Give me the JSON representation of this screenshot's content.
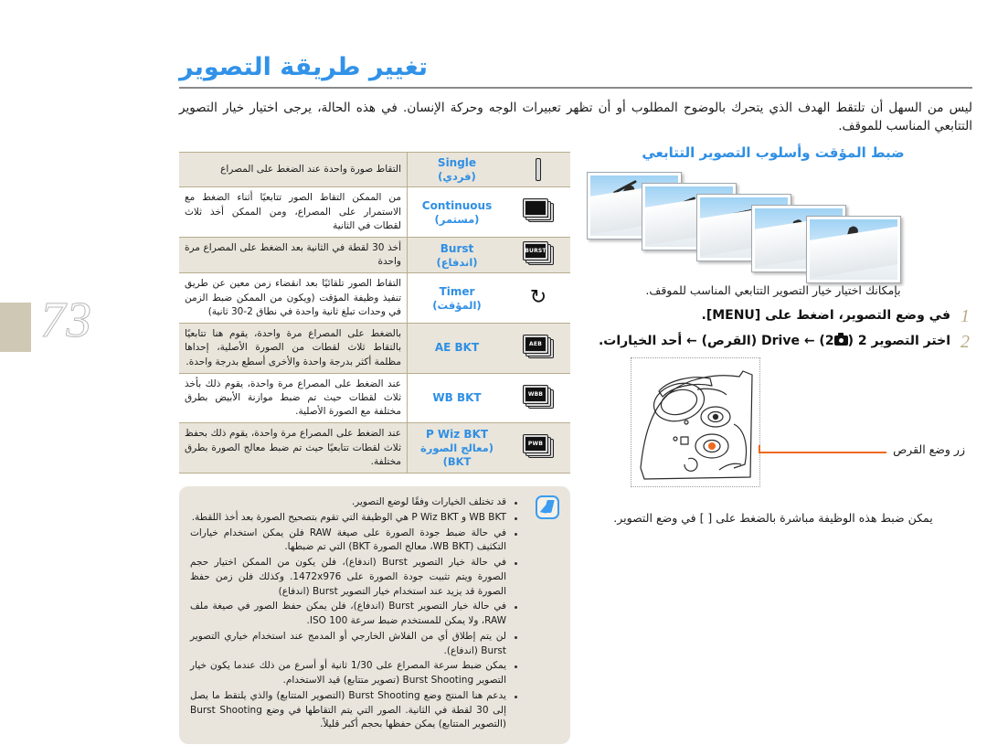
{
  "page": {
    "number": "73",
    "title": "تغيير طريقة التصوير",
    "intro": "ليس من السهل أن تلتقط الهدف الذي يتحرك بالوضوح المطلوب أو أن تظهر تعبيرات الوجه وحركة الإنسان. في هذه الحالة، يرجى اختيار خيار التصوير التتابعي المناسب للموقف."
  },
  "table": {
    "rows": [
      {
        "icon": "single-frame-icon",
        "name_en": "Single",
        "name_ar": "(فردي)",
        "desc": "التقاط صورة واحدة عند الضغط على المصراع"
      },
      {
        "icon": "continuous-frames-icon",
        "name_en": "Continuous",
        "name_ar": "(مستمر)",
        "desc": "من الممكن التقاط الصور تتابعيًا أثناء الضغط مع الاستمرار على المصراع، ومن الممكن أخذ ثلاث لقطات في الثانية"
      },
      {
        "icon": "burst-icon",
        "name_en": "Burst",
        "name_ar": "(اندفاع)",
        "desc": "أخذ 30 لقطة في الثانية بعد الضغط على المصراع مرة واحدة"
      },
      {
        "icon": "timer-icon",
        "name_en": "Timer",
        "name_ar": "(المؤقت)",
        "desc": "التقاط الصور تلقائيًا بعد انقضاء زمن معين عن طريق تنفيذ وظيفة المؤقت (ويكون من الممكن ضبط الزمن في وحدات تبلغ ثانية واحدة في نطاق 2-30 ثانية)"
      },
      {
        "icon": "aeb-icon",
        "name_en": "AE BKT",
        "name_ar": "",
        "desc": "بالضغط على المصراع مرة واحدة، يقوم هنا تتابعيًا بالتقاط ثلاث لقطات من الصورة الأصلية، إحداها مظلمة أكثر بدرجة واحدة والأخرى أسطع بدرجة واحدة."
      },
      {
        "icon": "wbb-icon",
        "name_en": "WB BKT",
        "name_ar": "",
        "desc": "عند الضغط على المصراع مرة واحدة، يقوم ذلك بأخذ ثلاث لقطات حيث تم ضبط موازنة الأبيض بطرق مختلفة مع الصورة الأصلية."
      },
      {
        "icon": "pwb-icon",
        "name_en": "P Wiz BKT",
        "name_ar": "(معالج الصورة BKT)",
        "desc": "عند الضغط على المصراع مرة واحدة، يقوم ذلك بحفظ ثلاث لقطات تتابعيًا حيث تم ضبط معالج الصورة بطرق مختلفة."
      }
    ]
  },
  "note": {
    "icon": "note-pen-icon",
    "items": [
      "قد تختلف الخيارات وفقًا لوضع التصوير.",
      "WB BKT و P Wiz BKT هي الوظيفة التي تقوم بتصحيح الصورة بعد أخذ اللقطة.",
      "في حالة ضبط جودة الصورة على صيغة RAW فلن يمكن استخدام خيارات التكثيف (WB BKT، معالج الصورة BKT) التي تم ضبطها.",
      "في حالة خيار التصوير Burst (اندفاع)، فلن يكون من الممكن اختيار حجم الصورة ويتم تثبيت جودة الصورة على 1472x976. وكذلك فلن زمن حفظ الصورة قد يزيد عند استخدام خيار التصوير Burst (اندفاع)",
      "في حالة خيار التصوير Burst (اندفاع)، فلن يمكن حفظ الصور في صيغة ملف RAW، ولا يمكن للمستخدم ضبط سرعة ISO 100.",
      "لن يتم إطلاق أي من الفلاش الخارجي أو المدمج عند استخدام خياري التصوير Burst (اندفاع).",
      "يمكن ضبط سرعة المصراع على 1/30 ثانية أو أسرع من ذلك عندما يكون خيار التصوير Burst Shooting (تصوير متتابع) قيد الاستخدام.",
      "يدعم هنا المنتج وضع Burst Shooting (التصوير المتتابع) والذي يلتقط ما يصل إلى 30 لقطة في الثانية. الصور التي يتم التقاطها في وضع Burst Shooting (التصوير المتتابع) يمكن حفظها بحجم أكبر قليلاً."
    ]
  },
  "right": {
    "subhead": "ضبط المؤقت وأسلوب التصوير التتابعي",
    "lead": "بإمكانك اختيار خيار التصوير التتابعي المناسب للموقف.",
    "steps": [
      {
        "num": "1",
        "text": "في وضع التصوير، اضغط على [MENU]."
      },
      {
        "num": "2",
        "text": "اختر التصوير 2 (2) ← Drive (القرص) ← أحد الخيارات."
      }
    ],
    "step2_parts": {
      "lead_ar": "اختر التصوير",
      "num": "2",
      "paren_num": "2",
      "drive_en": "Drive",
      "drive_ar": "(القرص)",
      "arrow": "←",
      "tail": "أحد الخيارات."
    },
    "figure": {
      "callout": "زر وضع القرص",
      "caption": "يمكن ضبط هذه الوظيفة مباشرة بالضغط على [ ] في وضع التصوير."
    }
  },
  "colors": {
    "accent_blue": "#2f8fe4",
    "title_blue": "#3192e8",
    "step_number": "#b9ab86",
    "row_shade": "#e9e5db",
    "note_bg": "#e9e5dd",
    "callout_orange": "#ef6a1f",
    "tab_tan": "#cfc8b4"
  }
}
